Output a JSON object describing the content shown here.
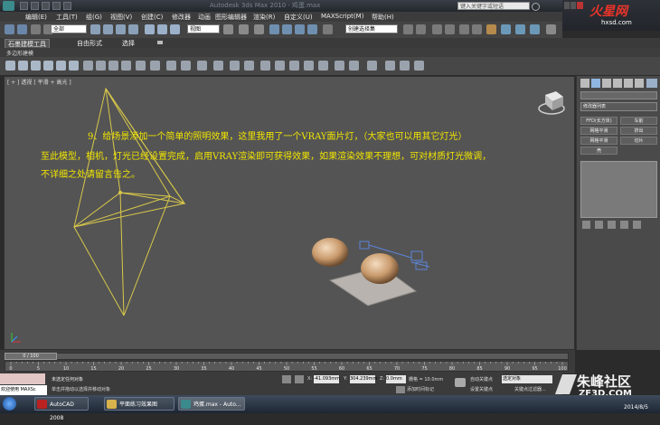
{
  "window": {
    "title": "Autodesk 3ds Max 2010 · 鸡蛋.max",
    "search_placeholder": "键入关键字或短语"
  },
  "watermark_top": {
    "brand": "火星网",
    "url": "hxsd.com"
  },
  "menu": [
    "编辑(E)",
    "工具(T)",
    "组(G)",
    "视图(V)",
    "创建(C)",
    "修改器",
    "动画",
    "图形编辑器",
    "渲染(R)",
    "自定义(U)",
    "MAXScript(M)",
    "帮助(H)"
  ],
  "toolbar": {
    "selection_filter": "全部",
    "view_dropdown": "视图",
    "named_selection": "创建选择集"
  },
  "ribbon": {
    "tabs": [
      "石墨建模工具",
      "自由形式",
      "选择"
    ],
    "sub_label": "多边形建模"
  },
  "viewport": {
    "label": "[ + ] 透视 [ 平滑 + 高光 ]",
    "caption_lines": [
      "9、给场景添加一个简单的照明效果，这里我用了一个VRAY面片灯，（大家也可以用其它灯光）",
      "至此模型，相机，灯光已经设置完成，启用VRAY渲染即可获得效果，如果渲染效果不理想，可对材质灯光微调，",
      "不详细之处请留言告之。"
    ]
  },
  "command_panel": {
    "modifier_list": "修改器列表",
    "buttons": [
      "FFD(长方体)",
      "车削",
      "网格平滑",
      "挤出",
      "网格平滑",
      "切片",
      "壳"
    ]
  },
  "timeline": {
    "frame_indicator": "0 / 100",
    "ticks": [
      "0",
      "5",
      "10",
      "15",
      "20",
      "25",
      "30",
      "35",
      "40",
      "45",
      "50",
      "55",
      "60",
      "65",
      "70",
      "75",
      "80",
      "85",
      "90",
      "95",
      "100"
    ]
  },
  "status": {
    "welcome": "欢迎使用 MAXSc",
    "selection_text": "未选定任何对象",
    "prompt_text": "单击并拖动以选择并移动对象",
    "x_label": "X:",
    "x_value": "-41.093mm",
    "y_label": "Y:",
    "y_value": "304.239mm",
    "z_label": "Z:",
    "z_value": "0.0mm",
    "grid_text": "栅格 = 10.0mm",
    "add_time_tag": "添加时间标记",
    "auto_key": "自动关键点",
    "selected_dropdown": "选定对象",
    "set_key": "设置关键点",
    "key_filters": "关键点过滤器..."
  },
  "taskbar": {
    "items": [
      "AutoCAD 2008",
      "平面练习效果图",
      "鸡蛋.max - Auto..."
    ],
    "date": "2014/8/5"
  },
  "watermark_bottom": {
    "brand": "朱峰社区",
    "url": "ZF3D.COM"
  }
}
